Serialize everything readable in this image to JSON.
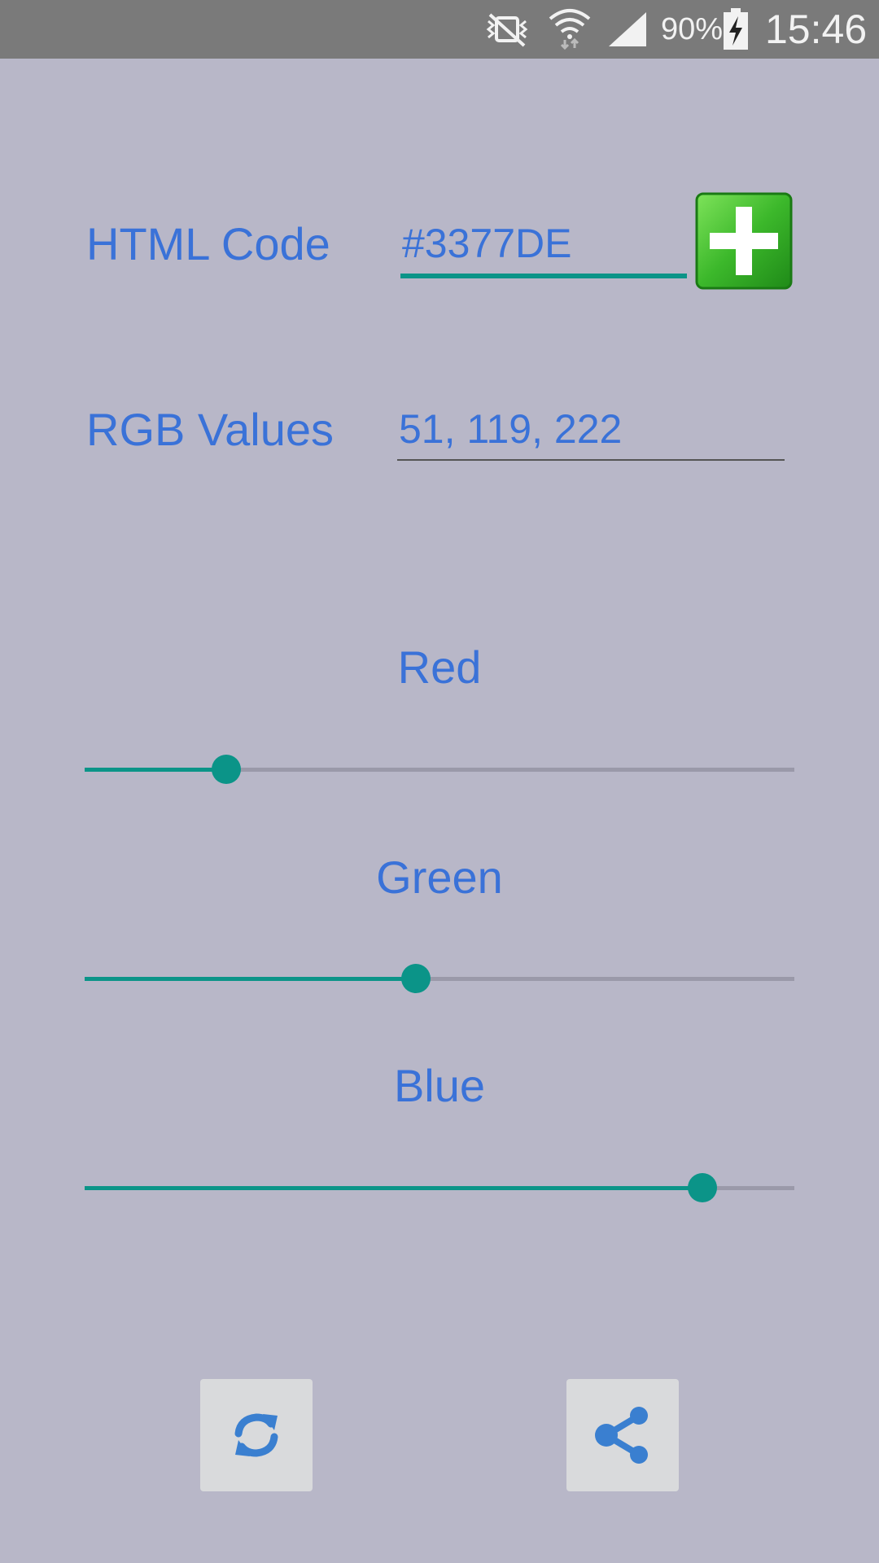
{
  "status_bar": {
    "battery_percent": "90%",
    "time": "15:46",
    "icons": [
      "vibrate-icon",
      "wifi-icon",
      "signal-icon",
      "battery-charging-icon"
    ]
  },
  "html_code": {
    "label": "HTML Code",
    "value": "#3377DE"
  },
  "rgb_values": {
    "label": "RGB Values",
    "value": "51, 119, 222"
  },
  "sliders": {
    "red": {
      "label": "Red",
      "value": 51,
      "max": 255
    },
    "green": {
      "label": "Green",
      "value": 119,
      "max": 255
    },
    "blue": {
      "label": "Blue",
      "value": 222,
      "max": 255
    }
  },
  "buttons": {
    "add": "plus-icon",
    "refresh": "refresh-icon",
    "share": "share-icon"
  },
  "colors": {
    "background": "#b8b7c8",
    "text_accent": "#3a72d8",
    "slider_accent": "#0b9488",
    "add_button_green": "#3cb82b"
  }
}
